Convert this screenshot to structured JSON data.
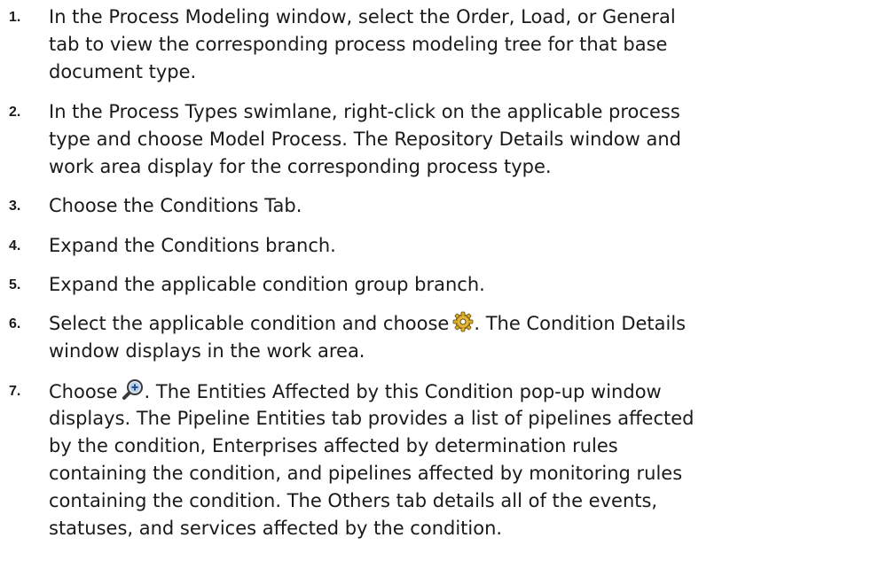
{
  "steps": [
    {
      "number": "1.",
      "lines": [
        "In the Process Modeling window, select the Order, Load, or General",
        "tab to view the corresponding process modeling tree for that base",
        "document type."
      ]
    },
    {
      "number": "2.",
      "lines": [
        "In the Process Types swimlane, right-click on the applicable process",
        "type and choose Model Process. The Repository Details window and",
        "work area display for the corresponding process type."
      ]
    },
    {
      "number": "3.",
      "lines": [
        "Choose the Conditions Tab."
      ]
    },
    {
      "number": "4.",
      "lines": [
        "Expand the Conditions branch."
      ]
    },
    {
      "number": "5.",
      "lines": [
        "Expand the applicable condition group branch."
      ]
    },
    {
      "number": "6.",
      "line1_before_icon": "Select the applicable condition and choose",
      "line1_after_icon": ". The Condition Details",
      "line2": "window displays in the work area.",
      "icon": "gear-properties-icon"
    },
    {
      "number": "7.",
      "line1_before_icon": "Choose",
      "line1_after_icon": ". The Entities Affected by this Condition pop-up window",
      "icon": "magnifier-plus-icon",
      "lines": [
        "displays. The Pipeline Entities tab provides a list of pipelines affected",
        "by the condition, Enterprises affected by determination rules",
        "containing the condition, and pipelines affected by monitoring rules",
        "containing the condition. The Others tab details all of the events,",
        "statuses, and services affected by the condition."
      ]
    }
  ]
}
